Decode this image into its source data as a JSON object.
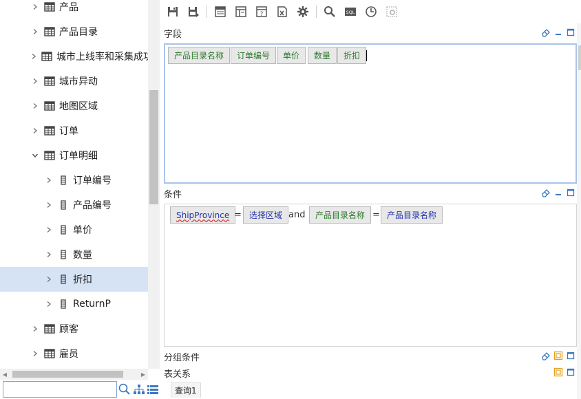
{
  "tree": {
    "items": [
      {
        "label": "产品",
        "kind": "table",
        "expanded": false,
        "indent": 0
      },
      {
        "label": "产品目录",
        "kind": "table",
        "expanded": false,
        "indent": 0
      },
      {
        "label": "城市上线率和采集成功",
        "kind": "table",
        "expanded": false,
        "indent": 0
      },
      {
        "label": "城市异动",
        "kind": "table",
        "expanded": false,
        "indent": 0
      },
      {
        "label": "地图区域",
        "kind": "table",
        "expanded": false,
        "indent": 0
      },
      {
        "label": "订单",
        "kind": "table",
        "expanded": false,
        "indent": 0
      },
      {
        "label": "订单明细",
        "kind": "table",
        "expanded": true,
        "indent": 0
      },
      {
        "label": "订单编号",
        "kind": "field",
        "expanded": false,
        "indent": 1
      },
      {
        "label": "产品编号",
        "kind": "field",
        "expanded": false,
        "indent": 1
      },
      {
        "label": "单价",
        "kind": "field",
        "expanded": false,
        "indent": 1
      },
      {
        "label": "数量",
        "kind": "field",
        "expanded": false,
        "indent": 1
      },
      {
        "label": "折扣",
        "kind": "field",
        "expanded": false,
        "indent": 1,
        "selected": true
      },
      {
        "label": "ReturnP",
        "kind": "field",
        "expanded": false,
        "indent": 1
      },
      {
        "label": "顾客",
        "kind": "table",
        "expanded": false,
        "indent": 0
      },
      {
        "label": "雇员",
        "kind": "table",
        "expanded": false,
        "indent": 0
      }
    ],
    "search_value": ""
  },
  "sections": {
    "fields_title": "字段",
    "conditions_title": "条件",
    "group_title": "分组条件",
    "relations_title": "表关系"
  },
  "fields": [
    "产品目录名称",
    "订单编号",
    "单价",
    "数量",
    "折扣"
  ],
  "condition": {
    "left1": "ShipProvince",
    "op1": "=",
    "right1": "选择区域",
    "joiner": "and",
    "left2": "产品目录名称",
    "op2": "=",
    "right2": "产品目录名称"
  },
  "query_tab": "查询1",
  "icons": {
    "toolbar": [
      "save-icon",
      "save-as-icon",
      "layout1-icon",
      "layout2-icon",
      "help-doc-icon",
      "excel-icon",
      "gear-icon",
      "search-icon",
      "sql-icon",
      "clock-icon",
      "settings-disabled-icon"
    ]
  },
  "colors": {
    "selected_row": "#d6e3f5",
    "green_text": "#2d7a2d",
    "blue_text": "#2233aa",
    "focus_border": "#a9c4ea"
  }
}
